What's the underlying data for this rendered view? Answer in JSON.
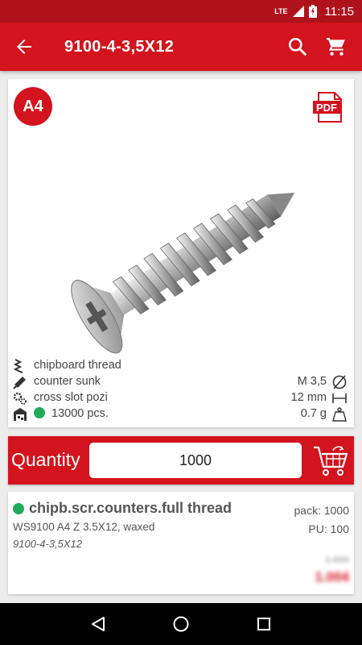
{
  "status_bar": {
    "network": "LTE",
    "time": "11:15"
  },
  "app_bar": {
    "title": "9100-4-3,5X12",
    "icons": [
      "arrow-back-icon",
      "search-icon",
      "cart-icon"
    ]
  },
  "product": {
    "badge": "A4",
    "pdf_label": "PDF",
    "image_alt": "screw-image",
    "specs": [
      {
        "icon": "thread-icon",
        "label": "chipboard thread",
        "value": "",
        "value_icon": ""
      },
      {
        "icon": "countersunk-icon",
        "label": "counter sunk",
        "value": "M 3,5",
        "value_icon": "diameter-icon"
      },
      {
        "icon": "gear-icon",
        "label": "cross slot pozi",
        "value": "12 mm",
        "value_icon": "length-icon"
      },
      {
        "icon": "warehouse-icon",
        "label": "13000 pcs.",
        "value": "0.7 g",
        "value_icon": "weight-icon"
      }
    ],
    "stock_color": "#1faa5c"
  },
  "quantity": {
    "label": "Quantity",
    "value": "1000"
  },
  "item": {
    "name": "chipb.scr.counters.full thread",
    "description": "WS9100 A4 Z 3.5X12, waxed",
    "code": "9100-4-3,5X12",
    "pack": "pack: 1000",
    "pu": "PU: 100",
    "price_old": "1.000",
    "price": "1.004"
  },
  "colors": {
    "accent": "#d3131d",
    "status": "#b0121b",
    "available": "#1faa5c"
  }
}
